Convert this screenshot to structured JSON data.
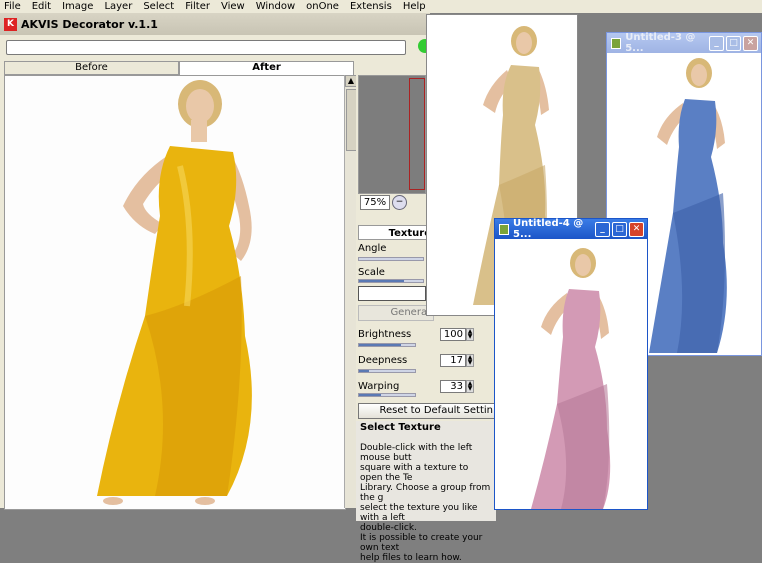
{
  "menu": [
    "File",
    "Edit",
    "Image",
    "Layer",
    "Select",
    "Filter",
    "View",
    "Window",
    "onOne",
    "Extensis",
    "Help"
  ],
  "akvis": {
    "title": "AKVIS Decorator v.1.1",
    "tabs": [
      "Before",
      "After"
    ],
    "zoom": "75%",
    "texture_header": "Texture",
    "angle_label": "Angle",
    "scale_label": "Scale",
    "generate_label": "Generat",
    "brightness_label": "Brightness",
    "brightness_value": "100",
    "deepness_label": "Deepness",
    "deepness_value": "17",
    "warping_label": "Warping",
    "warping_value": "33",
    "reset_label": "Reset to Default Settin",
    "help_title": "Select Texture",
    "help_lines": [
      "Double-click with the left mouse butt",
      "square with a texture to open the Te",
      "Library. Choose a group from the g",
      "select the texture you like with a left",
      "double-click.",
      "It is possible to create your own text",
      "help files to learn how."
    ],
    "brightness": 100,
    "deepness": 17,
    "warping": 33
  },
  "windows": {
    "untitled3": "Untitled-3 @ 5...",
    "untitled4": "Untitled-4 @ 5..."
  },
  "colors": {
    "dress_main": "#e9b40e",
    "dress_gold": "#d9c08a",
    "dress_blue": "#5a7fc4",
    "dress_pink": "#d39ab5",
    "xp_title": "#1c55c8"
  }
}
